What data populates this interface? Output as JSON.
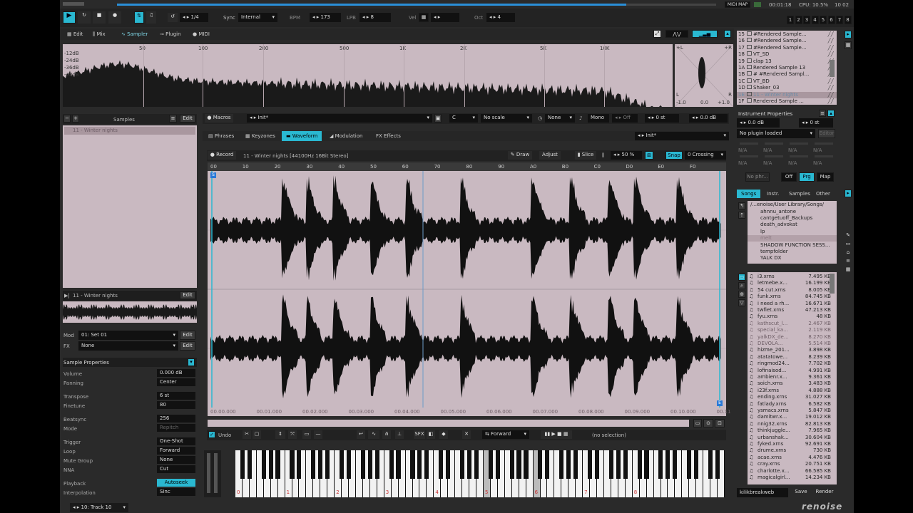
{
  "transport": {
    "edit_step": "1/4",
    "sync_label": "Sync",
    "sync_value": "Internal",
    "bpm_label": "BPM",
    "bpm": "173",
    "lpb_label": "LPB",
    "lpb": "8",
    "vel_label": "Vel",
    "oct_label": "Oct",
    "oct": "4",
    "midi_map": "MIDI MAP",
    "time": "00:01:18",
    "cpu": "CPU: 10.5%",
    "clock": "10 02",
    "tracks": [
      "1",
      "2",
      "3",
      "4",
      "5",
      "6",
      "7",
      "8"
    ]
  },
  "views": [
    "Edit",
    "Mix",
    "Sampler",
    "Plugin",
    "MIDI"
  ],
  "spectrum": {
    "freqs": [
      "50",
      "100",
      "200",
      "500",
      "1K",
      "2K",
      "5K",
      "10K"
    ],
    "db": [
      "-12dB",
      "-24dB",
      "-36dB",
      "-48dB"
    ],
    "scope_top_left": "+L",
    "scope_top_right": "+R",
    "scope_left": "L",
    "scope_right": "R",
    "scope_bottom": [
      "-1.0",
      "0.0",
      "+1.0"
    ]
  },
  "samples_panel": {
    "title": "Samples",
    "edit": "Edit",
    "items": [
      "11 - Winter nights"
    ],
    "preview_name": "11 - Winter nights",
    "preview_edit": "Edit",
    "mod_label": "Mod",
    "mod_value": "01: Set 01",
    "mod_edit": "Edit",
    "fx_label": "FX",
    "fx_value": "None",
    "fx_edit": "Edit"
  },
  "sample_properties": {
    "title": "Sample Properties",
    "rows": [
      {
        "label": "Volume",
        "value": "0.000 dB"
      },
      {
        "label": "Panning",
        "value": "Center"
      },
      {
        "label": "Transpose",
        "value": "6 st"
      },
      {
        "label": "Finetune",
        "value": "80"
      },
      {
        "label": "Beatsync",
        "value": "256"
      },
      {
        "label": "Mode",
        "value": "Repitch"
      },
      {
        "label": "Trigger",
        "value": "One-Shot"
      },
      {
        "label": "Loop",
        "value": "Forward"
      },
      {
        "label": "Mute Group",
        "value": "None"
      },
      {
        "label": "NNA",
        "value": "Cut"
      },
      {
        "label": "Playback",
        "value": "Autoseek"
      },
      {
        "label": "Interpolation",
        "value": "Sinc"
      }
    ]
  },
  "track_select": "10: Track 10",
  "macros_bar": {
    "macros": "Macros",
    "init": "Init*",
    "scale": "No scale",
    "key": "C",
    "none": "None",
    "mono": "Mono",
    "off": "Off",
    "transpose": "0 st",
    "vol": "0.0 dB"
  },
  "editor_tabs": [
    "Phrases",
    "Keyzones",
    "Waveform",
    "Modulation",
    "Effects"
  ],
  "editor_init": "Init*",
  "waveform": {
    "record": "Record",
    "info": "11 - Winter nights [44100Hz 16Bit Stereo]",
    "draw": "Draw",
    "adjust": "Adjust",
    "slice": "Slice",
    "slice_pct": "50 %",
    "snap": "Snap",
    "snap_mode": "0 Crossing",
    "ruler": [
      "00",
      "10",
      "20",
      "30",
      "40",
      "50",
      "60",
      "70",
      "80",
      "90",
      "A0",
      "B0",
      "C0",
      "D0",
      "E0",
      "F0"
    ],
    "times": [
      "00.00.000",
      "00.01.000",
      "00.02.000",
      "00.03.000",
      "00.04.000",
      "00.05.000",
      "00.06.000",
      "00.07.000",
      "00.08.000",
      "00.09.000",
      "00.10.000",
      "00.11"
    ]
  },
  "wave_tools": {
    "undo": "Undo",
    "sfx": "SFX",
    "loop_mode": "Forward",
    "selection": "(no selection)"
  },
  "keyboard": {
    "octaves": [
      "0",
      "1",
      "2",
      "3",
      "4",
      "5",
      "6",
      "7",
      "8"
    ]
  },
  "instruments": {
    "items": [
      {
        "n": "15",
        "name": "#Rendered Sample..."
      },
      {
        "n": "16",
        "name": "#Rendered Sample..."
      },
      {
        "n": "17",
        "name": "#Rendered Sample..."
      },
      {
        "n": "18",
        "name": "VT_SD"
      },
      {
        "n": "19",
        "name": "clap 13"
      },
      {
        "n": "1A",
        "name": "Rendered Sample 13"
      },
      {
        "n": "1B",
        "name": "# #Rendered Sampl..."
      },
      {
        "n": "1C",
        "name": "VT_BD"
      },
      {
        "n": "1D",
        "name": "Shaker_03"
      },
      {
        "n": "1E",
        "name": "11 - Winter nights"
      },
      {
        "n": "1F",
        "name": "Rendered Sample ..."
      }
    ]
  },
  "instrument_props": {
    "title": "Instrument Properties",
    "vol": "0.0 dB",
    "transpose": "0 st",
    "plugin": "No plugin loaded",
    "editor": "Editor",
    "na": "N/A",
    "no_phr": "No phr...",
    "off": "Off",
    "prg": "Prg",
    "map": "Map"
  },
  "browser": {
    "tabs": [
      "Songs",
      "Instr.",
      "Samples",
      "Other"
    ],
    "path": "/...enoise/User Library/Songs/",
    "folders": [
      "ahnnu_antone",
      "cantgetuoff_Backups",
      "death_advokat",
      "lp",
      "melt",
      "SHADOW FUNCTION SESS...",
      "tempfolder",
      "YALK DX"
    ],
    "files": [
      {
        "name": "i3.xrns",
        "size": "7.495 KB"
      },
      {
        "name": "letmebe.x...",
        "size": "16.199 KB"
      },
      {
        "name": "54 cut.xrns",
        "size": "8.005 KB"
      },
      {
        "name": "funk.xrns",
        "size": "84.745 KB"
      },
      {
        "name": "i need a rh...",
        "size": "16.671 KB"
      },
      {
        "name": "twfiet.xrns",
        "size": "47.213 KB"
      },
      {
        "name": "fyu.xrns",
        "size": "48 KB"
      },
      {
        "name": "kathscut_l...",
        "size": "2.467 KB"
      },
      {
        "name": "special_ka...",
        "size": "2.119 KB"
      },
      {
        "name": "yalkDX_de...",
        "size": "8.270 KB"
      },
      {
        "name": "DEVOLA...",
        "size": "5.514 KB"
      },
      {
        "name": "hizme_201...",
        "size": "3.898 KB"
      },
      {
        "name": "atatatowe...",
        "size": "8.239 KB"
      },
      {
        "name": "ringmod24...",
        "size": "7.702 KB"
      },
      {
        "name": "lofinaisod...",
        "size": "4.991 KB"
      },
      {
        "name": "ambienr.x...",
        "size": "9.361 KB"
      },
      {
        "name": "soich.xrns",
        "size": "3.483 KB"
      },
      {
        "name": "i23f.xrns",
        "size": "4.888 KB"
      },
      {
        "name": "ending.xrns",
        "size": "31.027 KB"
      },
      {
        "name": "fatlady.xrns",
        "size": "6.582 KB"
      },
      {
        "name": "ysmacs.xrns",
        "size": "5.847 KB"
      },
      {
        "name": "damitwr.x...",
        "size": "19.012 KB"
      },
      {
        "name": "nnig32.xrns",
        "size": "82.813 KB"
      },
      {
        "name": "thinkjuggle...",
        "size": "7.965 KB"
      },
      {
        "name": "urbanshak...",
        "size": "30.604 KB"
      },
      {
        "name": "fyked.xrns",
        "size": "92.691 KB"
      },
      {
        "name": "drume.xrns",
        "size": "730 KB"
      },
      {
        "name": "acae.xrns",
        "size": "4.476 KB"
      },
      {
        "name": "cray.xrns",
        "size": "20.751 KB"
      },
      {
        "name": "charlotte.x...",
        "size": "66.585 KB"
      },
      {
        "name": "magicalgirl...",
        "size": "14.234 KB"
      }
    ],
    "save_name": "kilikbreakweb",
    "save": "Save",
    "render": "Render"
  },
  "logo": "renoise",
  "colors": {
    "accent": "#2ab8d1",
    "waveform_bg": "#c9b9c1",
    "background": "#2a2a2a"
  }
}
